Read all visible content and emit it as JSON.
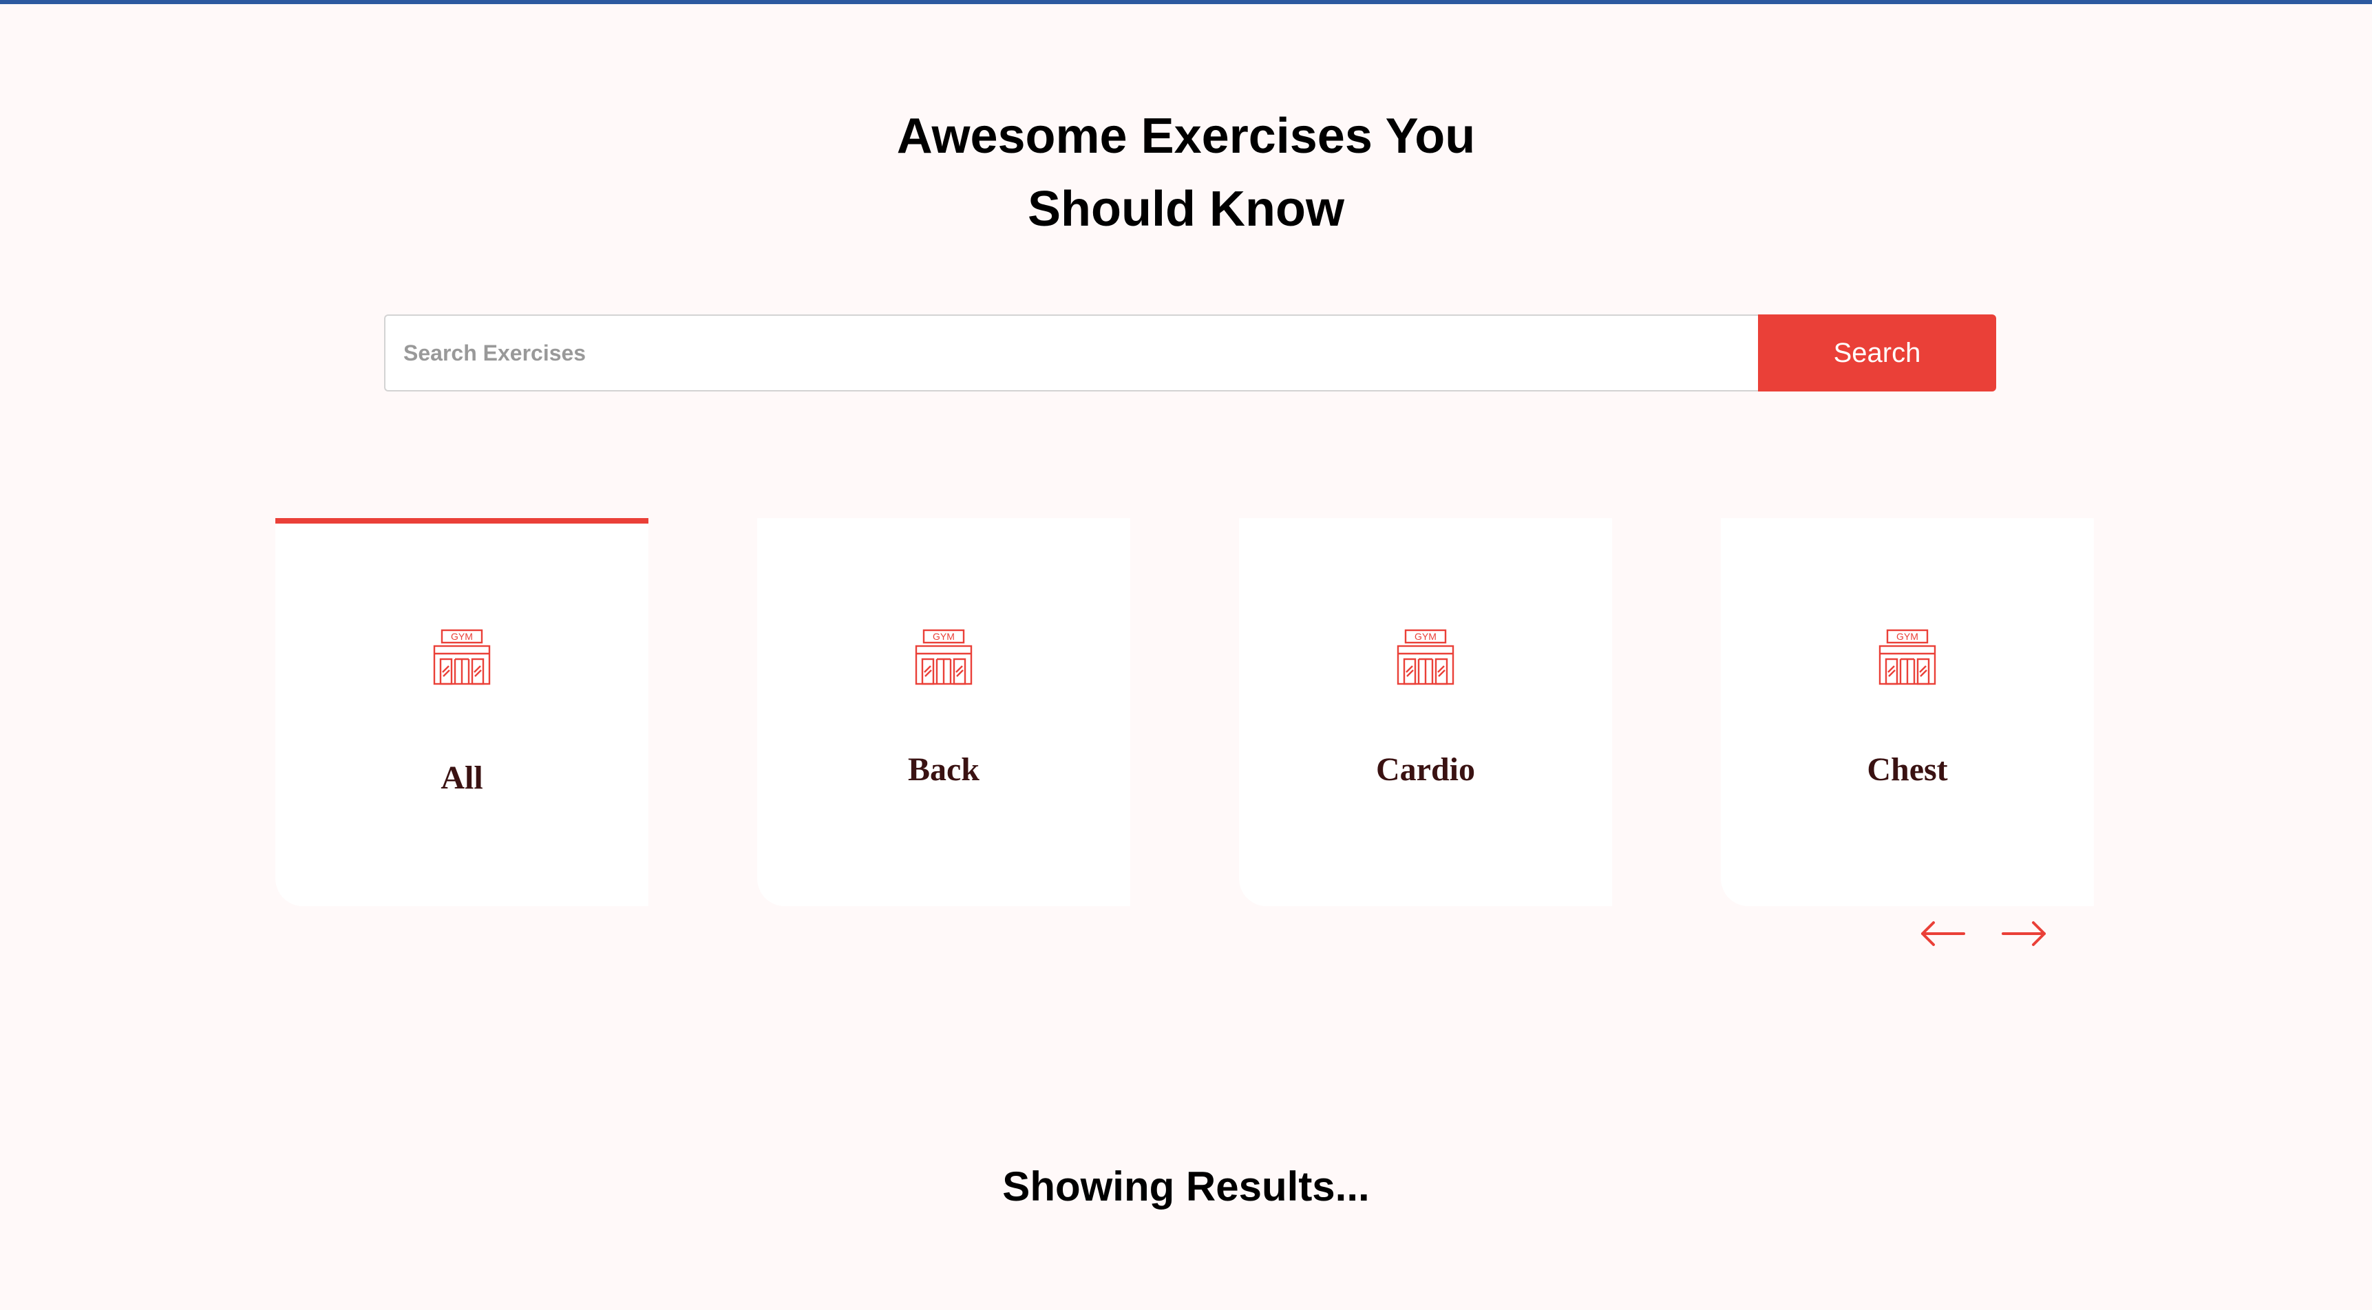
{
  "header": {
    "title_line1": "Awesome Exercises You",
    "title_line2": "Should Know"
  },
  "search": {
    "placeholder": "Search Exercises",
    "value": "",
    "button_label": "Search"
  },
  "body_parts": {
    "items": [
      {
        "label": "All",
        "icon": "gym-icon",
        "active": true
      },
      {
        "label": "Back",
        "icon": "gym-icon",
        "active": false
      },
      {
        "label": "Cardio",
        "icon": "gym-icon",
        "active": false
      },
      {
        "label": "Chest",
        "icon": "gym-icon",
        "active": false
      }
    ],
    "icon_text": "GYM",
    "prev_icon": "arrow-left-icon",
    "next_icon": "arrow-right-icon"
  },
  "results": {
    "title": "Showing Results..."
  },
  "colors": {
    "accent": "#ea4038",
    "background": "#fff9f9",
    "top_bar": "#2c5aa0",
    "card_label": "#3a1212"
  }
}
